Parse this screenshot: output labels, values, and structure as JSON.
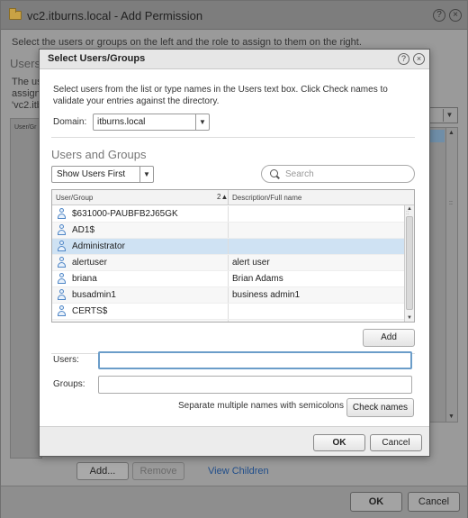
{
  "outer": {
    "title": "vc2.itburns.local - Add Permission",
    "instruction": "Select the users or groups on the left and the role to assign to them on the right.",
    "users_heading": "Users",
    "fragment1": "The us",
    "fragment2": "assigne",
    "fragment3": "'vc2.itb",
    "table_head": "User/Gr",
    "add_label": "Add...",
    "remove_label": "Remove",
    "view_children": "View Children",
    "ok_label": "OK",
    "cancel_label": "Cancel"
  },
  "modal": {
    "title": "Select Users/Groups",
    "instruction": "Select users from the list or type names in the Users text box. Click Check names to validate your entries against the directory.",
    "domain_label": "Domain:",
    "domain_value": "itburns.local",
    "section_heading": "Users and Groups",
    "show_option": "Show Users First",
    "search_placeholder": "Search",
    "col_user": "User/Group",
    "sort_indicator": "2▲",
    "col_desc": "Description/Full name",
    "rows": [
      {
        "name": "$631000-PAUBFB2J65GK",
        "desc": ""
      },
      {
        "name": "AD1$",
        "desc": ""
      },
      {
        "name": "Administrator",
        "desc": ""
      },
      {
        "name": "alertuser",
        "desc": "alert user"
      },
      {
        "name": "briana",
        "desc": "Brian Adams"
      },
      {
        "name": "busadmin1",
        "desc": "business admin1"
      },
      {
        "name": "CERTS$",
        "desc": ""
      },
      {
        "name": "",
        "desc": ""
      }
    ],
    "selected_row": 2,
    "add_label": "Add",
    "users_label": "Users:",
    "users_value": "",
    "groups_label": "Groups:",
    "groups_value": "",
    "hint": "Separate multiple names with semicolons",
    "check_names": "Check names",
    "ok_label": "OK",
    "cancel_label": "Cancel"
  },
  "icons": {
    "help": "?",
    "close": "×",
    "caret": "▼",
    "scroll_up": "▲",
    "scroll_down": "▼"
  },
  "colors": {
    "selection": "#cfe2f3",
    "link": "#1f4d8a",
    "user_icon": "#4f86c6"
  }
}
